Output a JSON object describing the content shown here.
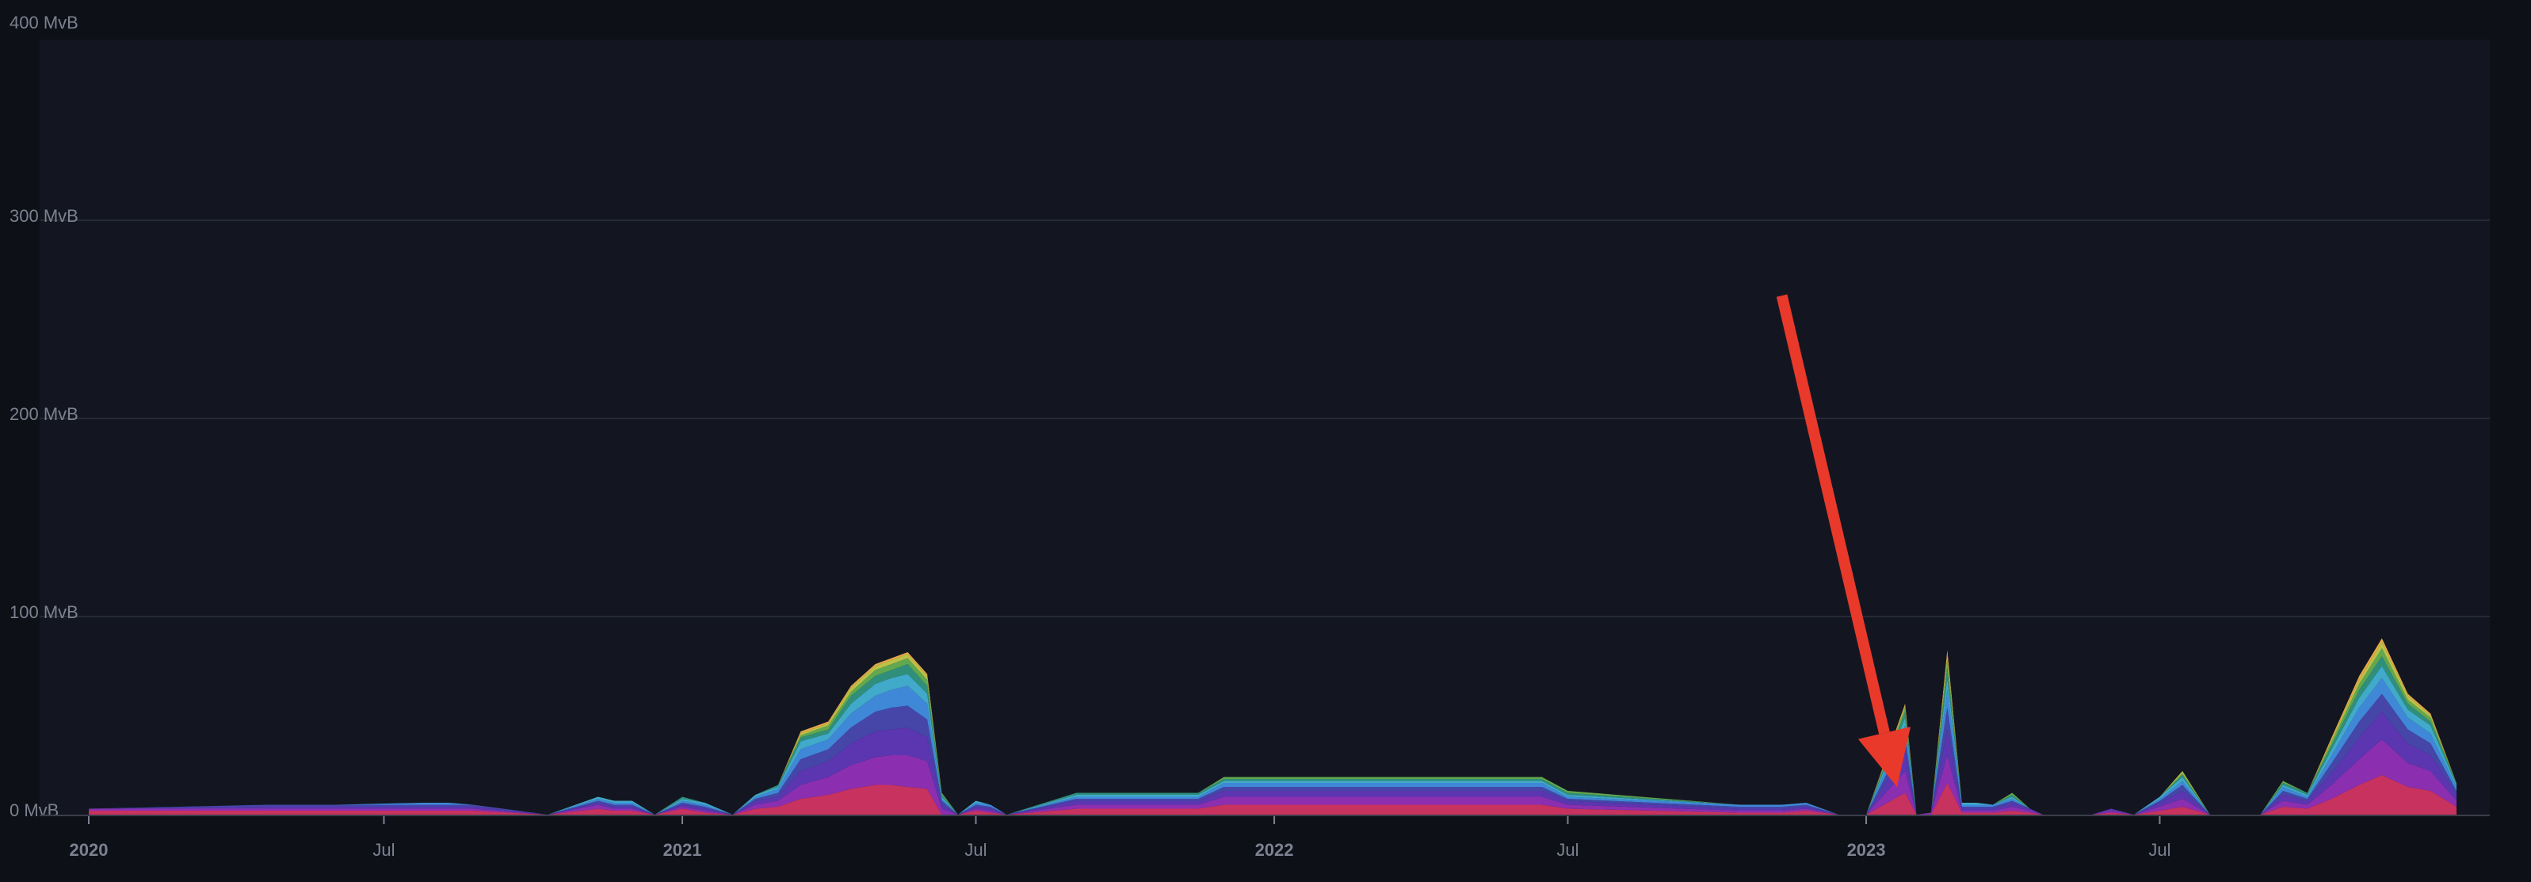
{
  "chart_data": {
    "type": "area",
    "stacked": true,
    "title": "",
    "xlabel": "",
    "ylabel": "",
    "ylim": [
      0,
      400
    ],
    "y_unit": "MvB",
    "y_ticks": [
      {
        "value": 0,
        "label": "0 MvB"
      },
      {
        "value": 100,
        "label": "100 MvB"
      },
      {
        "value": 200,
        "label": "200 MvB"
      },
      {
        "value": 300,
        "label": "300 MvB"
      },
      {
        "value": 400,
        "label": "400 MvB"
      }
    ],
    "x_range": [
      "2020-01-01",
      "2023-12-31"
    ],
    "x_ticks": [
      {
        "date": "2020-01-01",
        "label": "2020",
        "bold": true
      },
      {
        "date": "2020-07-01",
        "label": "Jul",
        "bold": false
      },
      {
        "date": "2021-01-01",
        "label": "2021",
        "bold": true
      },
      {
        "date": "2021-07-01",
        "label": "Jul",
        "bold": false
      },
      {
        "date": "2022-01-01",
        "label": "2022",
        "bold": true
      },
      {
        "date": "2022-07-01",
        "label": "Jul",
        "bold": false
      },
      {
        "date": "2023-01-01",
        "label": "2023",
        "bold": true
      },
      {
        "date": "2023-07-01",
        "label": "Jul",
        "bold": false
      }
    ],
    "grid": true,
    "legend": "none",
    "colors": {
      "background": "#0d1017",
      "plot_background": "#131620",
      "grid": "#262a35",
      "axis_text": "#7d8190",
      "baseline": "#3a3e4a",
      "annotation_arrow": "#e8392b"
    },
    "series": [
      {
        "color": "#c8325e"
      },
      {
        "color": "#8b2fb0"
      },
      {
        "color": "#5b36b0"
      },
      {
        "color": "#4546a8"
      },
      {
        "color": "#3f88d8"
      },
      {
        "color": "#41a9c9"
      },
      {
        "color": "#2f8f7a"
      },
      {
        "color": "#62a84e"
      },
      {
        "color": "#b9c247"
      },
      {
        "color": "#e6a84a"
      }
    ],
    "x": [
      "2020-01-01",
      "2020-04-20",
      "2020-05-05",
      "2020-05-15",
      "2020-06-01",
      "2020-07-25",
      "2020-08-10",
      "2020-08-25",
      "2020-10-10",
      "2020-11-10",
      "2020-11-20",
      "2020-12-01",
      "2020-12-15",
      "2021-01-01",
      "2021-01-15",
      "2021-02-01",
      "2021-02-15",
      "2021-03-01",
      "2021-03-15",
      "2021-04-01",
      "2021-04-15",
      "2021-04-30",
      "2021-05-10",
      "2021-05-20",
      "2021-06-01",
      "2021-06-10",
      "2021-06-20",
      "2021-07-01",
      "2021-07-10",
      "2021-07-20",
      "2021-09-01",
      "2021-11-15",
      "2021-12-01",
      "2022-01-01",
      "2022-06-15",
      "2022-07-01",
      "2022-10-15",
      "2022-11-10",
      "2022-11-25",
      "2022-12-15",
      "2023-01-01",
      "2023-01-25",
      "2023-02-01",
      "2023-02-10",
      "2023-02-20",
      "2023-03-01",
      "2023-03-10",
      "2023-03-20",
      "2023-04-01",
      "2023-04-12",
      "2023-04-20",
      "2023-05-01",
      "2023-05-10",
      "2023-05-20",
      "2023-06-01",
      "2023-06-15",
      "2023-07-01",
      "2023-07-15",
      "2023-08-01",
      "2023-08-15",
      "2023-09-01",
      "2023-09-15",
      "2023-09-30",
      "2023-10-15",
      "2023-11-01",
      "2023-11-15",
      "2023-12-01",
      "2023-12-15",
      "2023-12-31"
    ],
    "values": [
      [
        2,
        2,
        2,
        2,
        2,
        2,
        2,
        2,
        0,
        3,
        2,
        2,
        0,
        3,
        1,
        0,
        3,
        4,
        8,
        10,
        13,
        15,
        15,
        14,
        13,
        0,
        0,
        2,
        1,
        0,
        3,
        3,
        5,
        5,
        5,
        3,
        1,
        1,
        2,
        0,
        0,
        11,
        0,
        0,
        16,
        1,
        1,
        1,
        2,
        1,
        0,
        0,
        0,
        0,
        1,
        0,
        2,
        4,
        0,
        0,
        0,
        4,
        3,
        8,
        15,
        20,
        14,
        12,
        4
      ],
      [
        1,
        1,
        1,
        1,
        1,
        1,
        1,
        1,
        0,
        2,
        1,
        1,
        0,
        1,
        1,
        0,
        2,
        3,
        7,
        9,
        12,
        14,
        15,
        16,
        14,
        3,
        0,
        1,
        1,
        0,
        2,
        2,
        4,
        4,
        4,
        2,
        1,
        1,
        1,
        0,
        0,
        11,
        0,
        1,
        14,
        1,
        1,
        1,
        2,
        1,
        0,
        0,
        0,
        0,
        1,
        0,
        2,
        4,
        0,
        0,
        0,
        3,
        2,
        7,
        13,
        18,
        12,
        10,
        3
      ],
      [
        0,
        1,
        1,
        1,
        1,
        1,
        1,
        1,
        0,
        1,
        1,
        1,
        0,
        1,
        1,
        0,
        2,
        2,
        7,
        8,
        11,
        13,
        13,
        14,
        12,
        2,
        0,
        1,
        1,
        0,
        2,
        2,
        3,
        3,
        3,
        2,
        1,
        1,
        1,
        0,
        0,
        10,
        0,
        0,
        13,
        1,
        1,
        1,
        2,
        1,
        0,
        0,
        0,
        0,
        1,
        0,
        2,
        4,
        0,
        0,
        0,
        3,
        2,
        6,
        11,
        14,
        10,
        8,
        3
      ],
      [
        0,
        1,
        1,
        1,
        1,
        1,
        1,
        1,
        0,
        1,
        1,
        1,
        0,
        1,
        1,
        0,
        1,
        2,
        6,
        6,
        8,
        10,
        11,
        11,
        9,
        2,
        0,
        1,
        1,
        0,
        1,
        1,
        2,
        2,
        2,
        1,
        1,
        1,
        1,
        0,
        0,
        7,
        0,
        0,
        11,
        1,
        1,
        1,
        1,
        0,
        0,
        0,
        0,
        0,
        0,
        0,
        1,
        3,
        0,
        0,
        0,
        2,
        1,
        5,
        8,
        9,
        7,
        6,
        2
      ],
      [
        0,
        0,
        0,
        0,
        0,
        1,
        1,
        0,
        0,
        1,
        1,
        1,
        0,
        1,
        1,
        0,
        1,
        2,
        5,
        5,
        7,
        8,
        9,
        10,
        8,
        1,
        0,
        1,
        1,
        0,
        1,
        1,
        2,
        2,
        2,
        1,
        1,
        1,
        1,
        0,
        0,
        6,
        0,
        0,
        9,
        1,
        1,
        1,
        1,
        0,
        0,
        0,
        0,
        0,
        0,
        0,
        1,
        2,
        0,
        0,
        0,
        2,
        1,
        4,
        7,
        8,
        6,
        5,
        2
      ],
      [
        0,
        0,
        0,
        0,
        0,
        0,
        0,
        0,
        0,
        1,
        1,
        1,
        0,
        1,
        1,
        0,
        1,
        1,
        4,
        3,
        5,
        6,
        6,
        6,
        5,
        1,
        0,
        1,
        0,
        0,
        1,
        1,
        1,
        1,
        1,
        1,
        0,
        0,
        0,
        0,
        0,
        4,
        0,
        0,
        6,
        1,
        1,
        0,
        1,
        0,
        0,
        0,
        0,
        0,
        0,
        0,
        1,
        2,
        0,
        0,
        0,
        1,
        1,
        3,
        5,
        6,
        4,
        4,
        1
      ],
      [
        0,
        0,
        0,
        0,
        0,
        0,
        0,
        0,
        0,
        0,
        0,
        0,
        0,
        1,
        0,
        0,
        0,
        1,
        2,
        2,
        4,
        4,
        4,
        5,
        4,
        1,
        0,
        0,
        0,
        0,
        1,
        1,
        1,
        1,
        1,
        1,
        0,
        0,
        0,
        0,
        0,
        3,
        0,
        0,
        5,
        0,
        0,
        0,
        1,
        0,
        0,
        0,
        0,
        0,
        0,
        0,
        0,
        1,
        0,
        0,
        0,
        1,
        1,
        2,
        4,
        5,
        3,
        2,
        1
      ],
      [
        0,
        0,
        0,
        0,
        0,
        0,
        0,
        0,
        0,
        0,
        0,
        0,
        0,
        0,
        0,
        0,
        0,
        0,
        1,
        2,
        2,
        3,
        3,
        3,
        3,
        1,
        0,
        0,
        0,
        0,
        0,
        0,
        1,
        1,
        1,
        1,
        0,
        0,
        0,
        0,
        0,
        2,
        0,
        0,
        4,
        0,
        0,
        0,
        1,
        0,
        0,
        0,
        0,
        0,
        0,
        0,
        0,
        1,
        0,
        0,
        0,
        1,
        0,
        2,
        3,
        4,
        2,
        2,
        0
      ],
      [
        0,
        0,
        0,
        0,
        0,
        0,
        0,
        0,
        0,
        0,
        0,
        0,
        0,
        0,
        0,
        0,
        0,
        0,
        1,
        1,
        2,
        2,
        2,
        2,
        2,
        0,
        0,
        0,
        0,
        0,
        0,
        0,
        0,
        0,
        0,
        0,
        0,
        0,
        0,
        0,
        0,
        1,
        0,
        0,
        3,
        0,
        0,
        0,
        0,
        0,
        0,
        0,
        0,
        0,
        0,
        0,
        0,
        1,
        0,
        0,
        0,
        0,
        0,
        1,
        2,
        3,
        2,
        1,
        0
      ],
      [
        0,
        0,
        0,
        0,
        0,
        0,
        0,
        0,
        0,
        0,
        0,
        0,
        0,
        0,
        0,
        0,
        0,
        0,
        1,
        1,
        1,
        1,
        1,
        1,
        1,
        0,
        0,
        0,
        0,
        0,
        0,
        0,
        0,
        0,
        0,
        0,
        0,
        0,
        0,
        0,
        0,
        1,
        0,
        0,
        2,
        0,
        0,
        0,
        0,
        0,
        0,
        0,
        0,
        0,
        0,
        0,
        0,
        0,
        0,
        0,
        0,
        0,
        0,
        1,
        2,
        2,
        1,
        1,
        0
      ]
    ],
    "annotations": [
      {
        "type": "arrow",
        "from": {
          "x": "2022-11-10",
          "y": 262
        },
        "to": {
          "x": "2023-01-20",
          "y": 14
        }
      }
    ]
  }
}
